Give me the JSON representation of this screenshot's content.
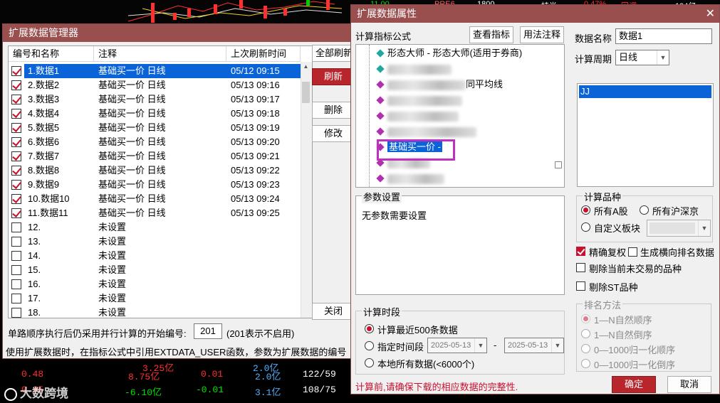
{
  "background": {
    "top_labels": [
      "11.00",
      "PRE6",
      "1800",
      "持半",
      "0.47%",
      "回调",
      "194亿"
    ],
    "rows": [
      [
        "0.48",
        "8.75亿",
        "0.01",
        "2.0亿",
        "122/59"
      ],
      [
        "0.35",
        "-6.10亿",
        "-0.01",
        "3.1亿",
        "108/75"
      ]
    ],
    "partial_values": [
      "3.25亿",
      "2.0亿"
    ],
    "watermark": "大数跨境",
    "colors": {
      "up": "#ff3030",
      "down": "#00e000",
      "neutral": "#4fb0ff",
      "white": "#ffffff"
    }
  },
  "manager": {
    "title": "扩展数据管理器",
    "columns": [
      "编号和名称",
      "注释",
      "上次刷新时间"
    ],
    "rows": [
      {
        "checked": true,
        "name": "1.数据1",
        "note": "基础买一价 日线",
        "time": "05/12 09:15"
      },
      {
        "checked": true,
        "name": "2.数据2",
        "note": "基础买一价 日线",
        "time": "05/13 09:16"
      },
      {
        "checked": true,
        "name": "3.数据3",
        "note": "基础买一价 日线",
        "time": "05/13 09:17"
      },
      {
        "checked": true,
        "name": "4.数据4",
        "note": "基础买一价 日线",
        "time": "05/13 09:18"
      },
      {
        "checked": true,
        "name": "5.数据5",
        "note": "基础买一价 日线",
        "time": "05/13 09:19"
      },
      {
        "checked": true,
        "name": "6.数据6",
        "note": "基础买一价 日线",
        "time": "05/13 09:20"
      },
      {
        "checked": true,
        "name": "7.数据7",
        "note": "基础买一价 日线",
        "time": "05/13 09:21"
      },
      {
        "checked": true,
        "name": "8.数据8",
        "note": "基础买一价 日线",
        "time": "05/13 09:22"
      },
      {
        "checked": true,
        "name": "9.数据9",
        "note": "基础买一价 日线",
        "time": "05/13 09:23"
      },
      {
        "checked": true,
        "name": "10.数据10",
        "note": "基础买一价 日线",
        "time": "05/13 09:24"
      },
      {
        "checked": true,
        "name": "11.数据11",
        "note": "基础买一价 日线",
        "time": "05/13 09:25"
      },
      {
        "checked": false,
        "name": "12.",
        "note": "未设置",
        "time": ""
      },
      {
        "checked": false,
        "name": "13.",
        "note": "未设置",
        "time": ""
      },
      {
        "checked": false,
        "name": "14.",
        "note": "未设置",
        "time": ""
      },
      {
        "checked": false,
        "name": "15.",
        "note": "未设置",
        "time": ""
      },
      {
        "checked": false,
        "name": "16.",
        "note": "未设置",
        "time": ""
      },
      {
        "checked": false,
        "name": "17.",
        "note": "未设置",
        "time": ""
      },
      {
        "checked": false,
        "name": "18.",
        "note": "未设置",
        "time": ""
      }
    ],
    "buttons": {
      "refresh_all": "全部刷新",
      "refresh": "刷新",
      "delete": "删除",
      "modify": "修改",
      "close": "关闭"
    },
    "start_label": "单路顺序执行后仍采用并行计算的开始编号:",
    "start_value": "201",
    "start_hint": "(201表示不启用)",
    "footer": "使用扩展数据时，在指标公式中引用EXTDATA_USER函数，参数为扩展数据的编号"
  },
  "props": {
    "title": "扩展数据属性",
    "close_glyph": "✕",
    "formula_label": "计算指标公式",
    "view_indicator": "查看指标",
    "usage_note": "用法注释",
    "tree": [
      {
        "label": "形态大师 - 形态大师(适用于券商)",
        "color": "#20a8a0",
        "blur": 0
      },
      {
        "label": "",
        "color": "#20a8a0",
        "blur": 90
      },
      {
        "label": "同平均线",
        "color": "#b030b0",
        "blur": 110
      },
      {
        "label": "",
        "color": "#b030b0",
        "blur": 105
      },
      {
        "label": "",
        "color": "#b030b0",
        "blur": 100
      },
      {
        "label": "",
        "color": "#b030b0",
        "blur": 125
      },
      {
        "label": "基础买一价 -",
        "color": "#b030b0",
        "blur": 0
      },
      {
        "label": "",
        "color": "#b030b0",
        "blur": 60
      },
      {
        "label": "",
        "color": "#b030b0",
        "blur": 80
      }
    ],
    "data_name_label": "数据名称",
    "data_name_value": "数据1",
    "period_label": "计算周期",
    "period_value": "日线",
    "output_item": "JJ",
    "params_title": "参数设置",
    "params_text": "无参数需要设置",
    "variety_title": "计算品种",
    "variety_options": [
      "所有A股",
      "所有沪深京",
      "自定义板块"
    ],
    "variety_selected": 0,
    "precise_label": "精确复权",
    "precise_checked": true,
    "horizontal_rank_label": "生成横向排名数据",
    "exclude_untraded": "剔除当前未交易的品种",
    "exclude_st": "剔除ST品种",
    "rank_title": "排名方法",
    "rank_options": [
      "1—N自然顺序",
      "1—N自然倒序",
      "0—1000归一化顺序",
      "0—1000归一化倒序"
    ],
    "time_title": "计算时段",
    "time_options": [
      "计算最近500条数据",
      "指定时间段",
      "本地所有数据(<6000个)"
    ],
    "time_selected": 0,
    "date_from": "2025-05-13",
    "date_to": "2025-05-13",
    "dash": "-",
    "warning": "计算前,请确保下载的相应数据的完整性.",
    "ok": "确定",
    "cancel": "取消"
  }
}
